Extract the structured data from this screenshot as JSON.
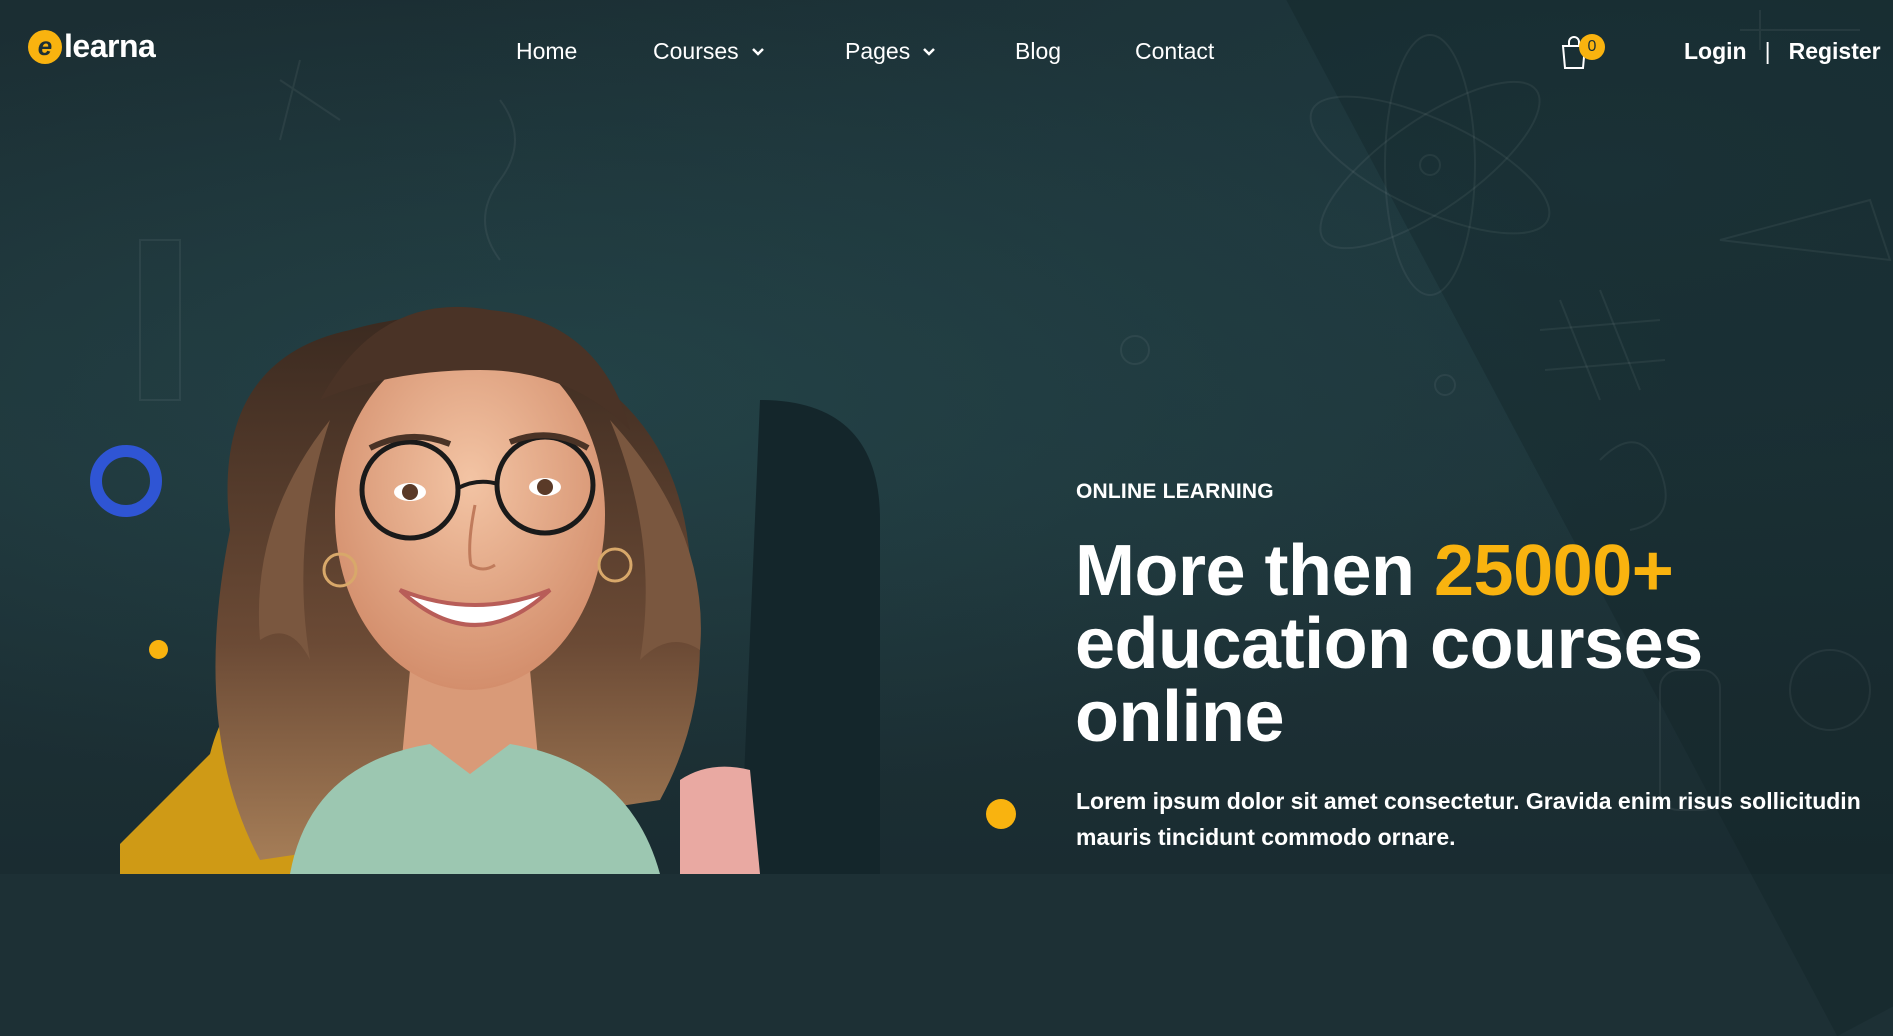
{
  "brand": {
    "logo_text": "learna",
    "logo_initial": "e",
    "accent": "#f9b30f"
  },
  "nav": {
    "items": [
      {
        "label": "Home",
        "dropdown": false
      },
      {
        "label": "Courses",
        "dropdown": true
      },
      {
        "label": "Pages",
        "dropdown": true
      },
      {
        "label": "Blog",
        "dropdown": false
      },
      {
        "label": "Contact",
        "dropdown": false
      }
    ],
    "cart_count": "0",
    "login": "Login",
    "separator": "|",
    "register": "Register"
  },
  "hero": {
    "eyebrow": "ONLINE LEARNING",
    "headline_part1": "More then ",
    "headline_highlight": "25000+",
    "headline_part2": "education courses online",
    "description": "Lorem ipsum dolor sit amet consectetur. Gravida enim risus sollicitudin mauris tincidunt commodo ornare."
  },
  "colors": {
    "background": "#1d3035",
    "accent_yellow": "#f9b30f",
    "accent_blue": "#2f55d4",
    "text": "#ffffff"
  }
}
